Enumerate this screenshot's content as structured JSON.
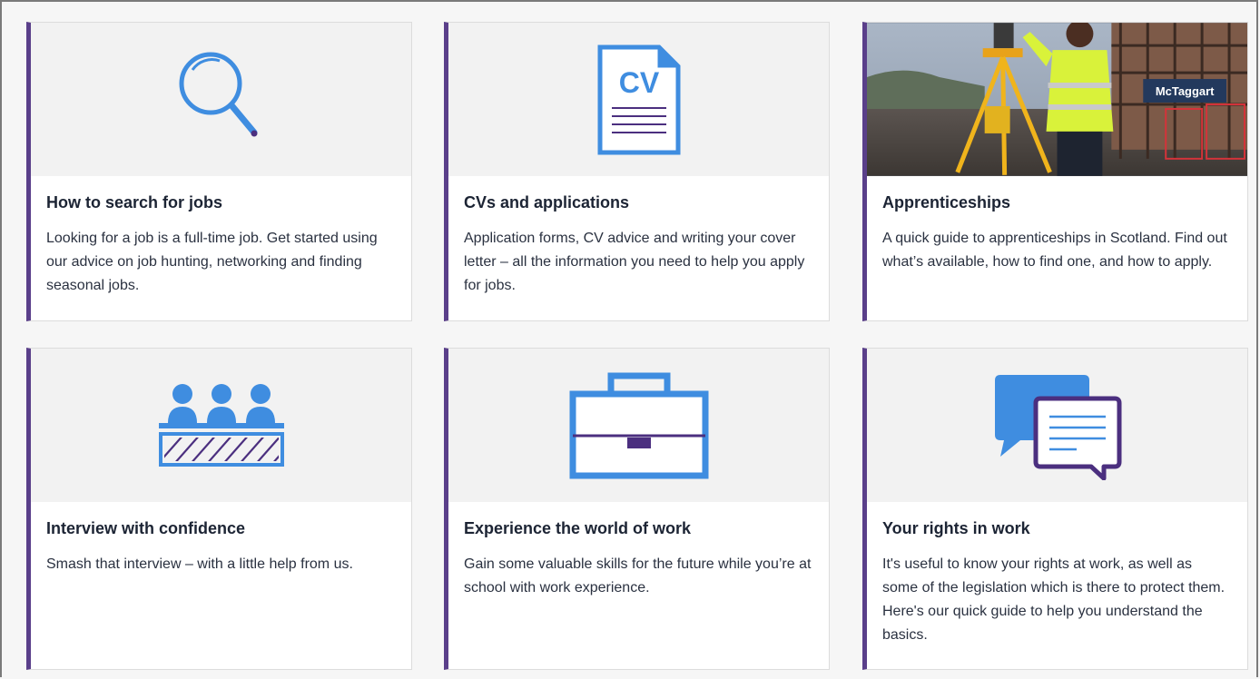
{
  "cards": [
    {
      "title": "How to search for jobs",
      "description": "Looking for a job is a full-time job. Get started using our advice on job hunting, networking and finding seasonal jobs.",
      "icon": "magnifying-glass-icon"
    },
    {
      "title": "CVs and applications",
      "description": "Application forms, CV advice and writing your cover letter – all the information you need to help you apply for jobs.",
      "icon": "cv-document-icon",
      "icon_text": "CV"
    },
    {
      "title": "Apprenticeships",
      "description": "A quick guide to apprenticeships in Scotland. Find out what’s available, how to find one, and how to apply.",
      "image": "apprentice-surveyor-photo",
      "sign_text": "McTaggart"
    },
    {
      "title": "Interview with confidence",
      "description": "Smash that interview – with a little help from us.",
      "icon": "interview-panel-icon"
    },
    {
      "title": "Experience the world of work",
      "description": "Gain some valuable skills for the future while you’re at school with work experience.",
      "icon": "briefcase-icon"
    },
    {
      "title": "Your rights in work",
      "description": "It's useful to know your rights at work, as well as some of the legislation which is there to protect them. Here's our quick guide to help you understand the basics.",
      "icon": "speech-bubbles-icon"
    }
  ],
  "colors": {
    "accent_border": "#5a3f8a",
    "icon_blue": "#3f8de0",
    "icon_purple": "#4b2f7f",
    "title": "#1c2434"
  }
}
